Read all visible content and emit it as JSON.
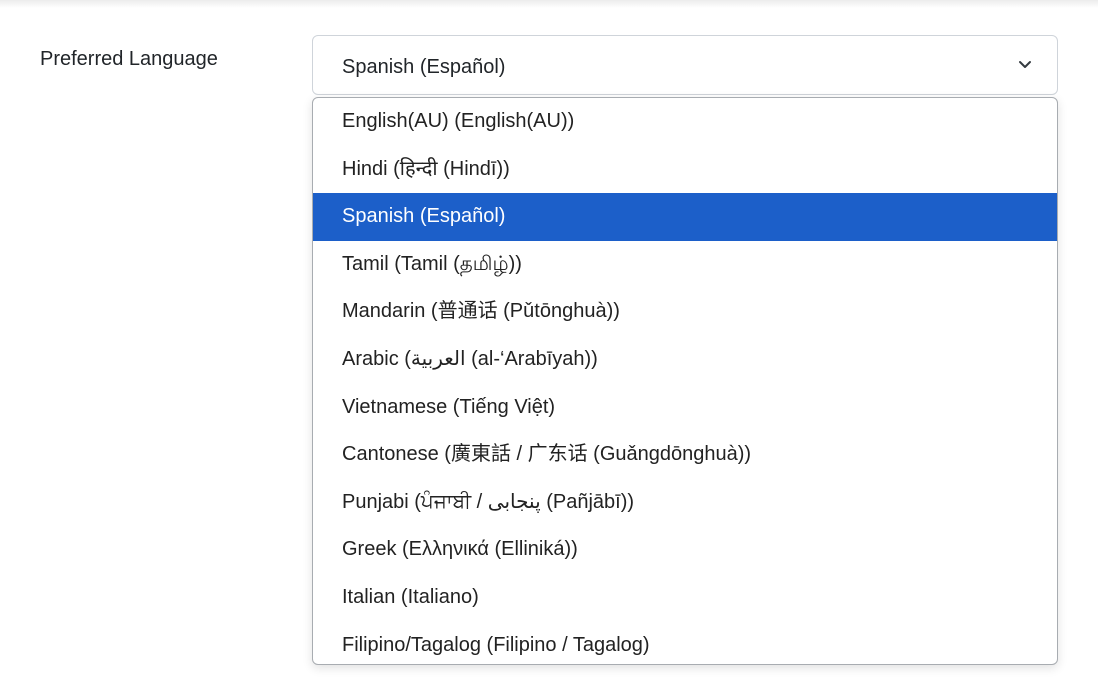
{
  "form": {
    "label": "Preferred Language",
    "selected_value": "Spanish (Español)"
  },
  "icons": {
    "select_arrow": "chevron-down-icon"
  },
  "colors": {
    "selected_bg": "#1c5fc9",
    "selected_text": "#ffffff",
    "text": "#222222"
  },
  "dropdown": {
    "selected_index": 2,
    "options": [
      {
        "label": "English(AU) (English(AU))"
      },
      {
        "label": "Hindi (हिन्दी (Hindī))"
      },
      {
        "label": "Spanish (Español)"
      },
      {
        "label": "Tamil (Tamil (தமிழ்))"
      },
      {
        "label": "Mandarin (普通话 (Pǔtōnghuà))"
      },
      {
        "label": "Arabic (العربية (al-‘Arabīyah))"
      },
      {
        "label": "Vietnamese (Tiếng Việt)"
      },
      {
        "label": "Cantonese (廣東話 / 广东话 (Guǎngdōnghuà))"
      },
      {
        "label": "Punjabi (ਪੰਜਾਬੀ / پنجابی (Pañjābī))"
      },
      {
        "label": "Greek (Ελληνικά (Elliniká))"
      },
      {
        "label": "Italian (Italiano)"
      },
      {
        "label": "Filipino/Tagalog (Filipino / Tagalog)"
      }
    ]
  }
}
